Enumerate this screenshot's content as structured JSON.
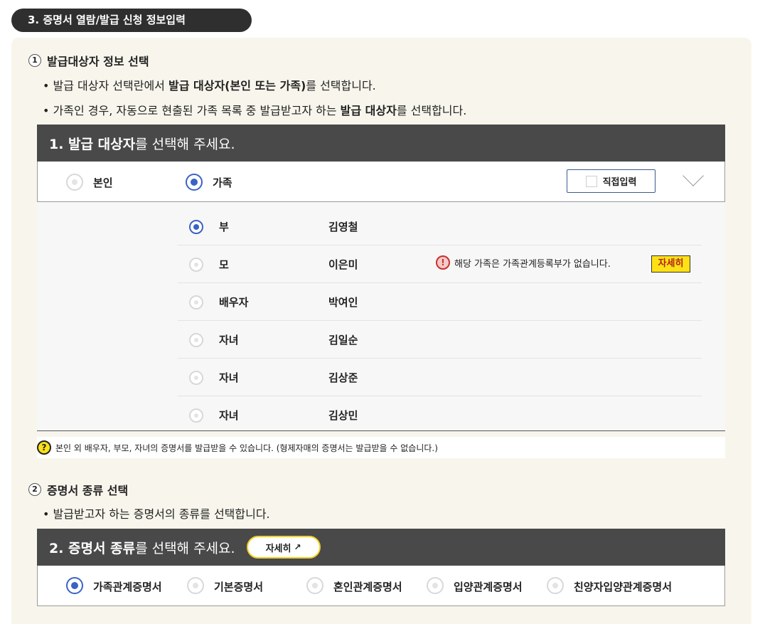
{
  "section": {
    "title": "3. 증명서 열람/발급 신청 정보입력"
  },
  "step1": {
    "num": "1",
    "title": "발급대상자 정보 선택",
    "bullet1": {
      "pre": "발급 대상자 선택란에서 ",
      "bold": "발급 대상자(본인 또는 가족)",
      "post": "를 선택합니다."
    },
    "bullet2": {
      "pre": "가족인 경우, 자동으로 현출된 가족 목록 중 발급받고자 하는 ",
      "bold": "발급 대상자",
      "post": "를 선택합니다."
    }
  },
  "panel1": {
    "head_bold": "1. 발급 대상자",
    "head_rest": "를 선택해 주세요.",
    "option_self": "본인",
    "option_family": "가족",
    "direct_input": "직접입력"
  },
  "family": [
    {
      "relation": "부",
      "name": "김영철",
      "selected": true
    },
    {
      "relation": "모",
      "name": "이은미",
      "selected": false,
      "warning": "해당 가족은 가족관계등록부가 없습니다.",
      "detail": "자세히"
    },
    {
      "relation": "배우자",
      "name": "박여인",
      "selected": false
    },
    {
      "relation": "자녀",
      "name": "김일순",
      "selected": false
    },
    {
      "relation": "자녀",
      "name": "김상준",
      "selected": false
    },
    {
      "relation": "자녀",
      "name": "김상민",
      "selected": false
    }
  ],
  "note": {
    "icon": "?",
    "text": "본인 외 배우자, 부모, 자녀의 증명서를 발급받을 수 있습니다. (형제자매의 증명서는 발급받을 수 없습니다.)"
  },
  "step2": {
    "num": "2",
    "title": "증명서 종류 선택",
    "bullet1": "발급받고자 하는 증명서의 종류를 선택합니다."
  },
  "panel2": {
    "head_bold": "2. 증명서 종류",
    "head_rest": "를 선택해 주세요.",
    "detail": "자세히",
    "options": [
      "가족관계증명서",
      "기본증명서",
      "혼인관계증명서",
      "입양관계증명서",
      "친양자입양관계증명서"
    ]
  },
  "icons": {
    "warning": "!",
    "external": "↗"
  },
  "colors": {
    "accent_blue": "#3b63c4",
    "dark_header": "#494949",
    "highlight_yellow": "#fde116",
    "warning_red": "#c7322d"
  }
}
